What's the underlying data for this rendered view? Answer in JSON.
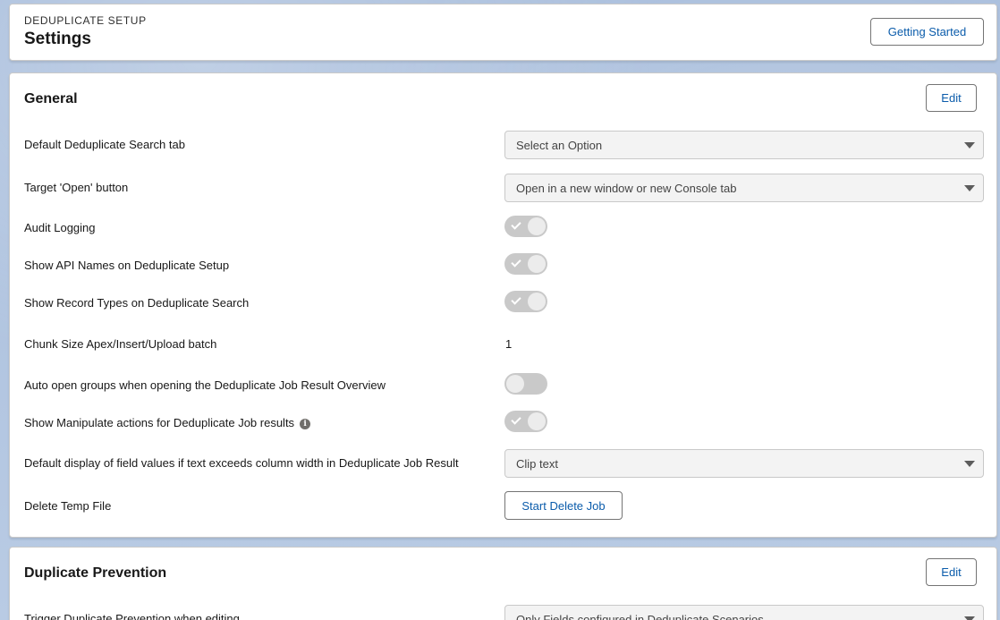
{
  "header": {
    "eyebrow": "DEDUPLICATE SETUP",
    "title": "Settings",
    "getting_started_label": "Getting Started"
  },
  "general": {
    "title": "General",
    "edit_label": "Edit",
    "default_search_tab": {
      "label": "Default Deduplicate Search tab",
      "value": "Select an Option"
    },
    "target_open_button": {
      "label": "Target 'Open' button",
      "value": "Open in a new window or new Console tab"
    },
    "audit_logging": {
      "label": "Audit Logging",
      "enabled": true
    },
    "show_api_names": {
      "label": "Show API Names on Deduplicate Setup",
      "enabled": true
    },
    "show_record_types": {
      "label": "Show Record Types on Deduplicate Search",
      "enabled": true
    },
    "chunk_size": {
      "label": "Chunk Size Apex/Insert/Upload batch",
      "value": "1"
    },
    "auto_open_groups": {
      "label": "Auto open groups when opening the Deduplicate Job Result Overview",
      "enabled": false
    },
    "show_manipulate_actions": {
      "label": "Show Manipulate actions for Deduplicate Job results",
      "enabled": true,
      "info_icon": "i"
    },
    "default_display": {
      "label": "Default display of field values if text exceeds column width in Deduplicate Job Result",
      "value": "Clip text"
    },
    "delete_temp_file": {
      "label": "Delete Temp File",
      "button_label": "Start Delete Job"
    }
  },
  "prevention": {
    "title": "Duplicate Prevention",
    "edit_label": "Edit",
    "trigger": {
      "label": "Trigger Duplicate Prevention when editing",
      "value": "Only Fields configured in Deduplicate Scenarios"
    }
  },
  "colors": {
    "link_blue": "#0b5cab",
    "toggle_disabled": "#c9c9c9",
    "background": "#b0c4df"
  }
}
